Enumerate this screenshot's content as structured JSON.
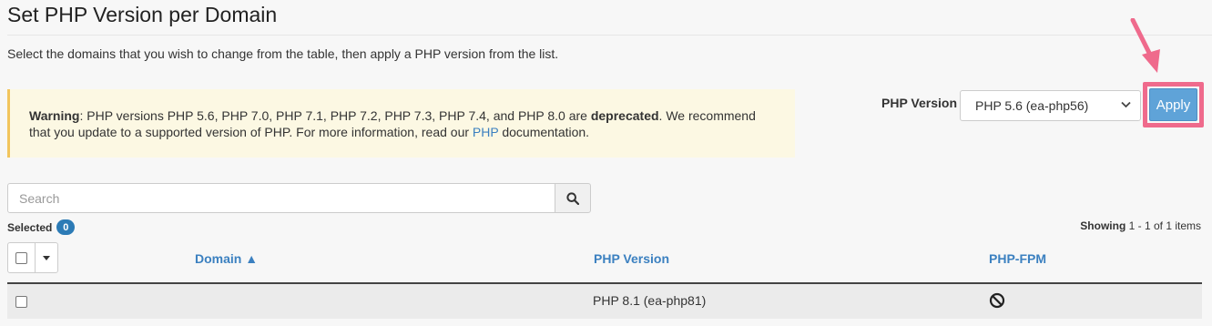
{
  "page": {
    "title": "Set PHP Version per Domain",
    "intro": "Select the domains that you wish to change from the table, then apply a PHP version from the list."
  },
  "warning": {
    "label": "Warning",
    "text_before": ": PHP versions PHP 5.6, PHP 7.0, PHP 7.1, PHP 7.2, PHP 7.3, PHP 7.4, and PHP 8.0 are ",
    "bold_word": "deprecated",
    "text_after": ". We recommend that you update to a supported version of PHP. For more information, read our ",
    "link": "PHP",
    "text_end": " documentation."
  },
  "php_version": {
    "label": "PHP Version",
    "selected": "PHP 5.6 (ea-php56)",
    "apply_label": "Apply"
  },
  "search": {
    "placeholder": "Search",
    "icon": "search-icon"
  },
  "selected": {
    "label": "Selected",
    "count": "0"
  },
  "showing": {
    "label": "Showing",
    "range": "1 - 1 of 1 items"
  },
  "table": {
    "columns": [
      "Domain ▲",
      "PHP Version",
      "PHP-FPM"
    ],
    "rows": [
      {
        "domain": "",
        "php_version": "PHP 8.1 (ea-php81)",
        "php_fpm_icon": "disabled-icon"
      }
    ]
  },
  "colors": {
    "accent": "#3b80c0",
    "apply_button": "#5fa3d8",
    "highlight": "#ef6a8c",
    "warning_bg": "#fcf8e3"
  }
}
